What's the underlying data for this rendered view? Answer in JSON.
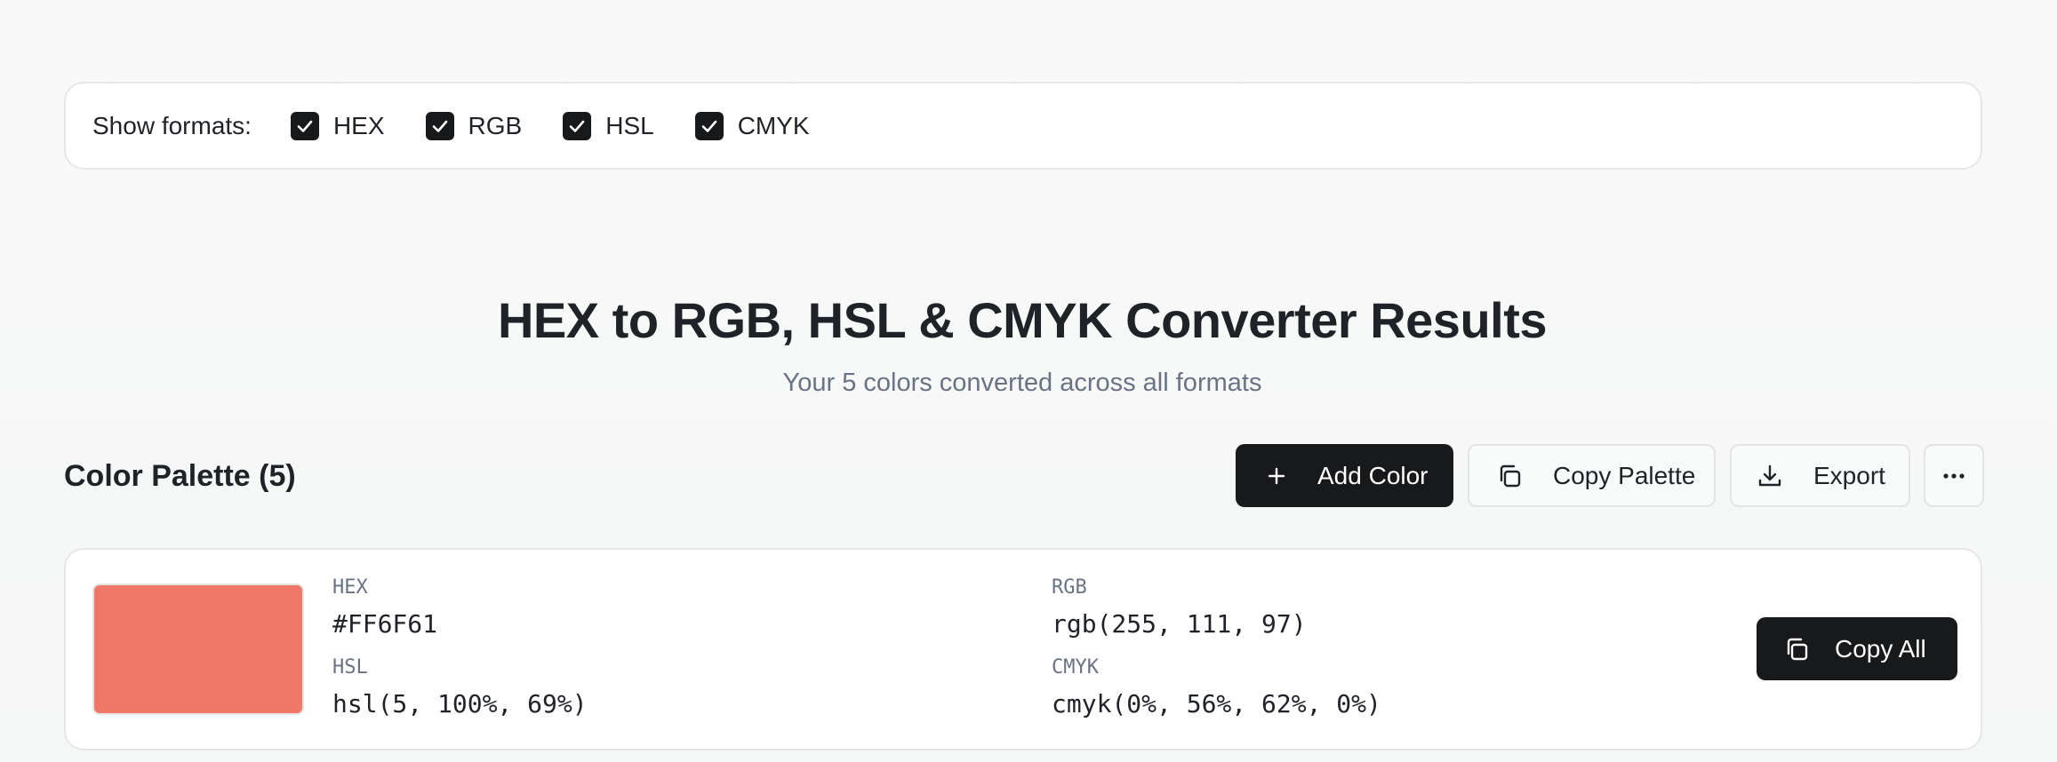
{
  "formats_bar": {
    "label": "Show formats:",
    "options": [
      {
        "label": "HEX",
        "checked": true
      },
      {
        "label": "RGB",
        "checked": true
      },
      {
        "label": "HSL",
        "checked": true
      },
      {
        "label": "CMYK",
        "checked": true
      }
    ]
  },
  "header": {
    "title": "HEX to RGB, HSL & CMYK Converter Results",
    "subtitle": "Your 5 colors converted across all formats"
  },
  "palette": {
    "title": "Color Palette (5)",
    "actions": {
      "add_color": "Add Color",
      "copy_palette": "Copy Palette",
      "export": "Export",
      "more_icon": "ellipsis-icon"
    }
  },
  "colors": [
    {
      "swatch_color": "#EF7868",
      "hex_label": "HEX",
      "hex_value": "#FF6F61",
      "rgb_label": "RGB",
      "rgb_value": "rgb(255, 111, 97)",
      "hsl_label": "HSL",
      "hsl_value": "hsl(5, 100%, 69%)",
      "cmyk_label": "CMYK",
      "cmyk_value": "cmyk(0%, 56%, 62%, 0%)",
      "copy_all": "Copy All"
    }
  ]
}
